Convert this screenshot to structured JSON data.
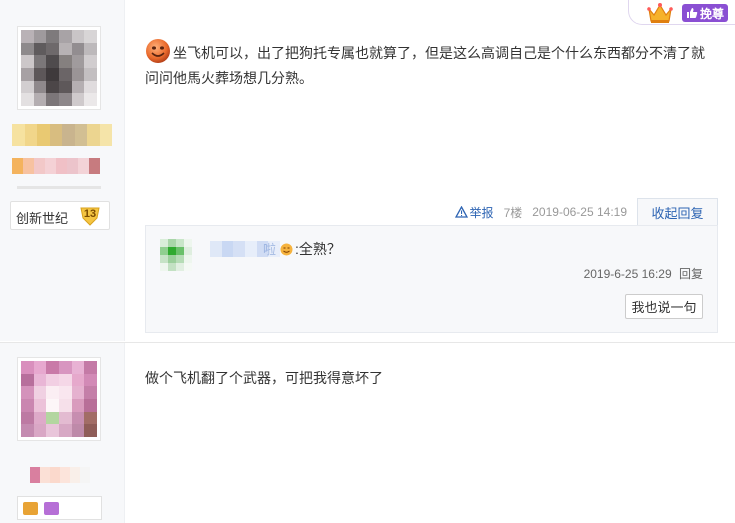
{
  "vip_corner": {
    "badge_label": "挽尊"
  },
  "posts": [
    {
      "author": {
        "level_name": "创新世纪",
        "level_number": "13"
      },
      "content": "坐飞机可以，出了把狗托专属也就算了，但是这么高调自己是个什么东西都分不清了就问问他馬火葬场想几分熟。",
      "tail": {
        "report_label": "举报",
        "floor": "7楼",
        "time": "2019-06-25 14:19",
        "reply_toggle_label": "收起回复"
      },
      "replies": [
        {
          "user_suffix": "啦",
          "text": ":全熟？",
          "time": "2019-6-25 16:29",
          "reply_label": "回复"
        }
      ],
      "add_reply_label": "我也说一句"
    },
    {
      "content": "做个飞机翻了个武器，可把我得意坏了"
    }
  ],
  "colors": {
    "link_blue": "#2d64b3",
    "sidebar_bg": "#f7f8fa",
    "vip_purple": "#8a4fd3",
    "level_badge_gold": "#f5c542"
  },
  "icons": {
    "report": "warning-triangle-icon",
    "crown": "crown-icon",
    "vip": "thumb-icon",
    "post_emoji": "smiley-icon"
  }
}
